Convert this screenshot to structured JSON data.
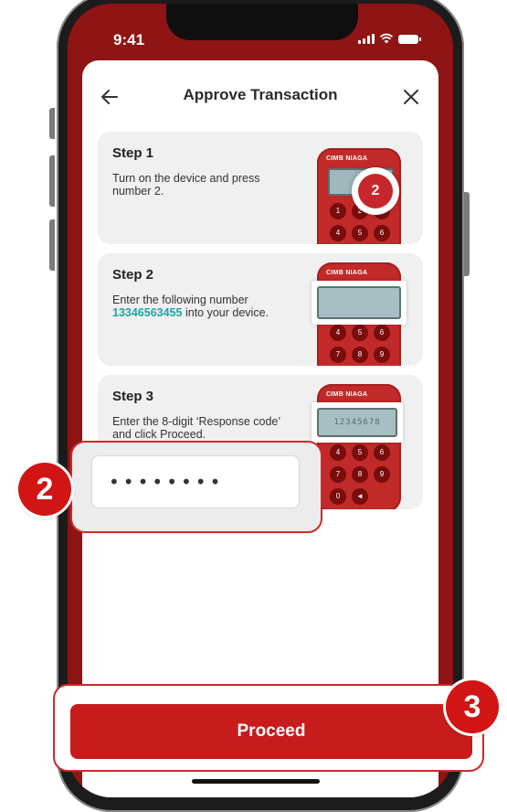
{
  "status_bar": {
    "time": "9:41"
  },
  "header": {
    "title": "Approve Transaction",
    "back_icon": "arrow-left-icon",
    "close_icon": "close-icon"
  },
  "steps": [
    {
      "title": "Step 1",
      "text": "Turn on the device and press number 2.",
      "device_highlight": "2"
    },
    {
      "title": "Step 2",
      "text_before": "Enter the following number",
      "code": "13346563455",
      "text_after": "into your device."
    },
    {
      "title": "Step 3",
      "text": "Enter the 8-digit ‘Response code’ and click Proceed.",
      "device_display": "12345678"
    }
  ],
  "device": {
    "brand": "CIMB NIAGA",
    "keys": [
      "1",
      "2",
      "3",
      "4",
      "5",
      "6",
      "7",
      "8",
      "9",
      "0",
      "◄"
    ]
  },
  "response_input": {
    "value": "••••••••"
  },
  "callouts": {
    "input_number": "2",
    "button_number": "3"
  },
  "actions": {
    "proceed_label": "Proceed"
  },
  "colors": {
    "brand_red": "#c81b1b",
    "code_teal": "#16a9a5",
    "status_bar": "#8f1414"
  }
}
